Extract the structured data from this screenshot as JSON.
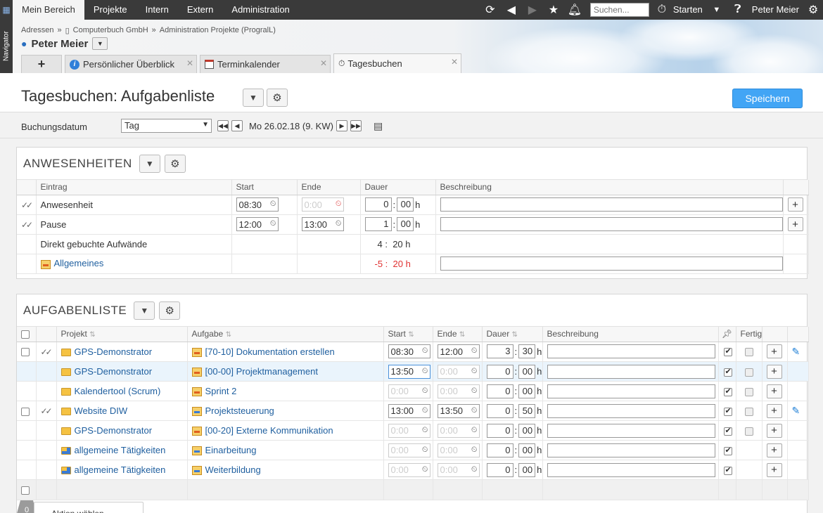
{
  "topbar": {
    "nav": [
      "Mein Bereich",
      "Projekte",
      "Intern",
      "Extern",
      "Administration"
    ],
    "search_placeholder": "Suchen...",
    "start_label": "Starten",
    "user_label": "Peter Meier"
  },
  "navigator_label": "Navigator",
  "breadcrumb": [
    "Adressen",
    "»",
    "Computerbuch GmbH",
    "»",
    "Administration Projekte (ProgralL)"
  ],
  "user_name": "Peter Meier",
  "tabs": [
    {
      "label": "Persönlicher Überblick"
    },
    {
      "label": "Terminkalender"
    },
    {
      "label": "Tagesbuchen"
    }
  ],
  "page_title": "Tagesbuchen: Aufgabenliste",
  "save_label": "Speichern",
  "datebar": {
    "label": "Buchungsdatum",
    "period": "Tag",
    "date_text": "Mo 26.02.18 (9. KW)"
  },
  "anwesenheiten": {
    "title": "ANWESENHEITEN",
    "columns": [
      "Eintrag",
      "Start",
      "Ende",
      "Dauer",
      "Beschreibung"
    ],
    "rows": [
      {
        "entry": "Anwesenheit",
        "start": "08:30",
        "end": "0:00",
        "dur_h": "0",
        "dur_m": "00"
      },
      {
        "entry": "Pause",
        "start": "12:00",
        "end": "13:00",
        "dur_h": "1",
        "dur_m": "00"
      },
      {
        "entry": "Direkt gebuchte Aufwände",
        "dur_text_h": "4",
        "dur_text_m": "20"
      },
      {
        "entry": "Allgemeines",
        "dur_text_h": "-5",
        "dur_text_m": "20"
      }
    ],
    "h_suffix": "h"
  },
  "aufgabenliste": {
    "title": "AUFGABENLISTE",
    "columns": [
      "Projekt",
      "Aufgabe",
      "Start",
      "Ende",
      "Dauer",
      "Beschreibung",
      "Fertig"
    ],
    "rows": [
      {
        "project": "GPS-Demonstrator",
        "task": "[70-10] Dokumentation erstellen",
        "start": "08:30",
        "end": "12:00",
        "dur_h": "3",
        "dur_m": "30"
      },
      {
        "project": "GPS-Demonstrator",
        "task": "[00-00] Projektmanagement",
        "start": "13:50",
        "end": "0:00",
        "dur_h": "0",
        "dur_m": "00"
      },
      {
        "project": "Kalendertool (Scrum)",
        "task": "Sprint 2",
        "start": "0:00",
        "end": "0:00",
        "dur_h": "0",
        "dur_m": "00"
      },
      {
        "project": "Website DIW",
        "task": "Projektsteuerung",
        "start": "13:00",
        "end": "13:50",
        "dur_h": "0",
        "dur_m": "50"
      },
      {
        "project": "GPS-Demonstrator",
        "task": "[00-20] Externe Kommunikation",
        "start": "0:00",
        "end": "0:00",
        "dur_h": "0",
        "dur_m": "00"
      },
      {
        "project": "allgemeine Tätigkeiten",
        "task": "Einarbeitung",
        "start": "0:00",
        "end": "0:00",
        "dur_h": "0",
        "dur_m": "00"
      },
      {
        "project": "allgemeine Tätigkeiten",
        "task": "Weiterbildung",
        "start": "0:00",
        "end": "0:00",
        "dur_h": "0",
        "dur_m": "00"
      }
    ]
  },
  "bottom": {
    "badge": "0",
    "action_label": "Aktion wählen"
  },
  "colors": {
    "accent": "#42a5f5",
    "topbar": "#3a3a3a",
    "link": "#1f5f9f",
    "negative": "#e03030"
  }
}
